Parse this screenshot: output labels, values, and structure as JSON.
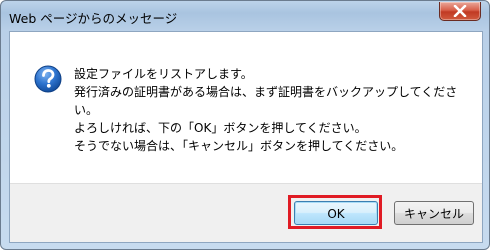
{
  "window": {
    "title": "Web ページからのメッセージ",
    "close_icon": "close-icon"
  },
  "dialog": {
    "icon": "question-icon",
    "message_lines": [
      "設定ファイルをリストアします。",
      "発行済みの証明書がある場合は、まず証明書をバックアップしてくださ",
      "い。",
      "よろしければ、下の「OK」ボタンを押してください。",
      "そうでない場合は、「キャンセル」ボタンを押してください。"
    ]
  },
  "buttons": {
    "ok_label": "OK",
    "cancel_label": "キャンセル"
  },
  "colors": {
    "highlight": "#e01b24",
    "close_button": "#c13a23",
    "icon_blue": "#1f63b8"
  }
}
